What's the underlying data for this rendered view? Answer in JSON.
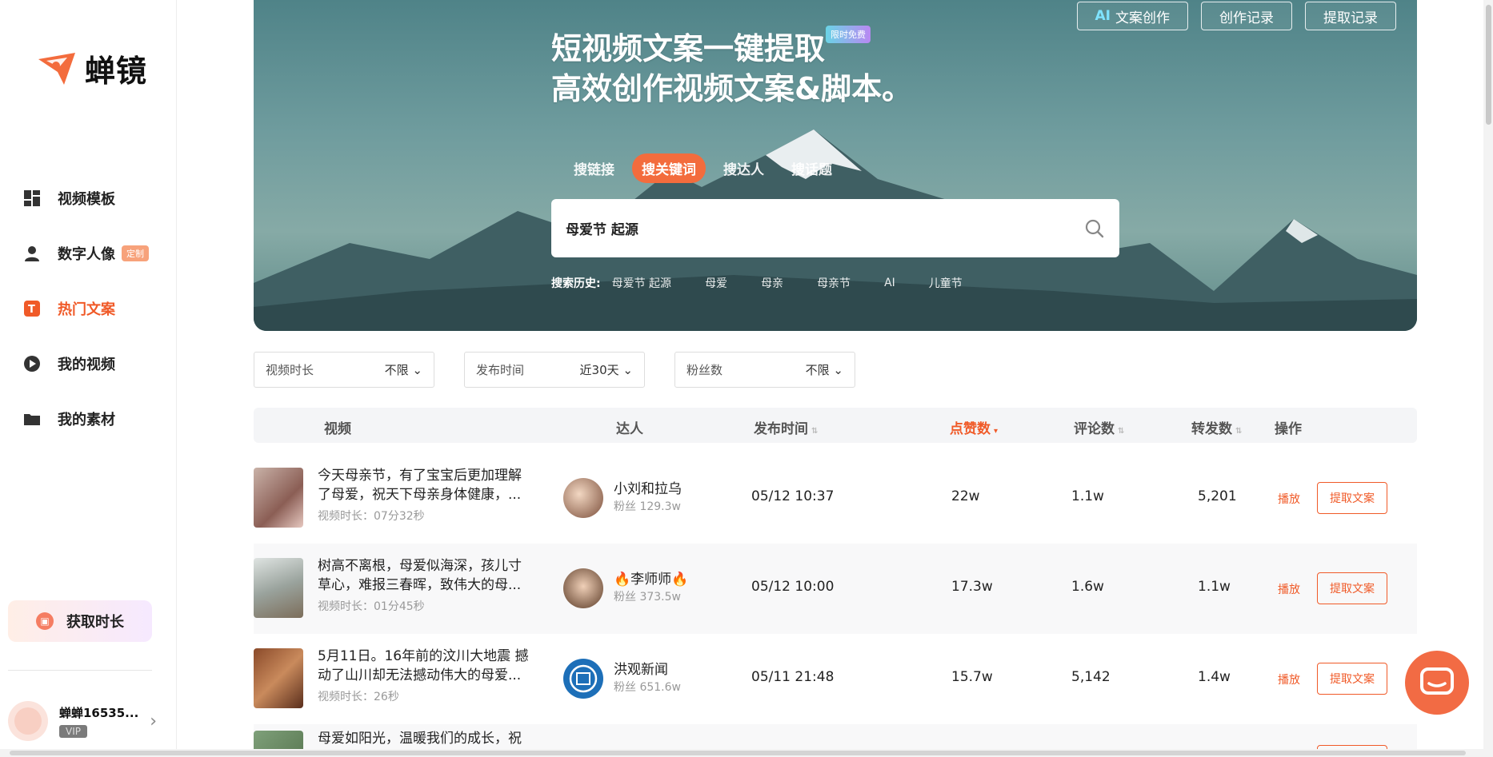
{
  "brand": {
    "name": "蝉镜",
    "accent": "#f05a28"
  },
  "sidebar": {
    "items": [
      {
        "label": "视频模板",
        "icon": "grid-icon"
      },
      {
        "label": "数字人像",
        "icon": "person-icon",
        "badge": "定制"
      },
      {
        "label": "热门文案",
        "icon": "text-doc-icon",
        "active": true
      },
      {
        "label": "我的视频",
        "icon": "play-circle-icon"
      },
      {
        "label": "我的素材",
        "icon": "folder-icon"
      }
    ],
    "get_time_label": "获取时长",
    "user": {
      "name": "蝉蝉16535...",
      "vip": "VIP"
    }
  },
  "hero": {
    "title_line1": "短视频文案一键提取",
    "title_line2": "高效创作视频文案&脚本。",
    "free_badge": "限时免费",
    "buttons": {
      "ai_prefix": "AI",
      "ai_label": "文案创作",
      "records": "创作记录",
      "extract_records": "提取记录"
    },
    "tabs": [
      "搜链接",
      "搜关键词",
      "搜达人",
      "搜话题"
    ],
    "active_tab": "搜关键词",
    "search_value": "母爱节 起源",
    "history_label": "搜索历史:",
    "history": [
      "母爱节 起源",
      "母爱",
      "母亲",
      "母亲节",
      "AI",
      "儿童节"
    ]
  },
  "filters": [
    {
      "label": "视频时长",
      "value": "不限"
    },
    {
      "label": "发布时间",
      "value": "近30天"
    },
    {
      "label": "粉丝数",
      "value": "不限"
    }
  ],
  "table": {
    "headers": {
      "video": "视频",
      "creator": "达人",
      "publish_time": "发布时间",
      "likes": "点赞数",
      "comments": "评论数",
      "shares": "转发数",
      "action": "操作"
    },
    "play_label": "播放",
    "extract_label": "提取文案",
    "rows": [
      {
        "title": "今天母亲节，有了宝宝后更加理解了母爱，祝天下母亲身体健康，...",
        "duration": "视频时长：07分32秒",
        "creator": "小刘和拉乌",
        "fans": "粉丝 129.3w",
        "time": "05/12 10:37",
        "likes": "22w",
        "comments": "1.1w",
        "shares": "5,201"
      },
      {
        "title": "树高不离根，母爱似海深，孩儿寸草心，难报三春晖，致伟大的母...",
        "duration": "视频时长：01分45秒",
        "creator": "🔥李师师🔥",
        "fans": "粉丝 373.5w",
        "time": "05/12 10:00",
        "likes": "17.3w",
        "comments": "1.6w",
        "shares": "1.1w"
      },
      {
        "title": "5月11日。16年前的汶川大地震 撼动了山川却无法撼动伟大的母爱...",
        "duration": "视频时长：26秒",
        "creator": "洪观新闻",
        "fans": "粉丝 651.6w",
        "time": "05/11 21:48",
        "likes": "15.7w",
        "comments": "5,142",
        "shares": "1.4w"
      },
      {
        "title": "母爱如阳光，温暖我们的成长，祝",
        "duration": "",
        "creator": "",
        "fans": "",
        "time": "",
        "likes": "",
        "comments": "",
        "shares": ""
      }
    ]
  }
}
